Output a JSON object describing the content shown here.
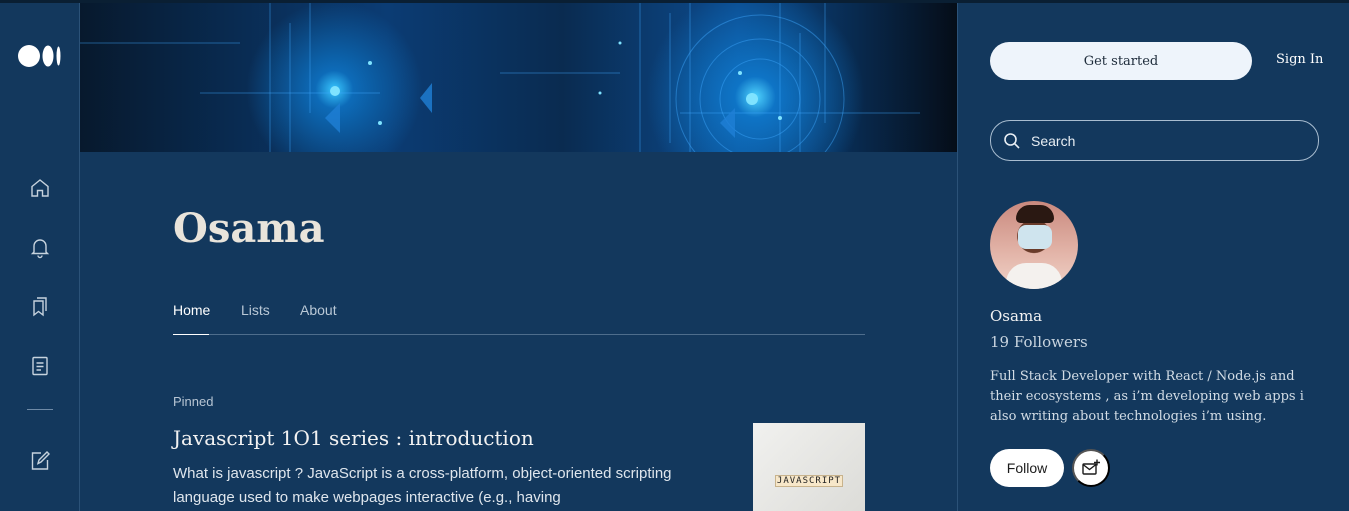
{
  "rail": {
    "logo_icon": "medium-logo-icon",
    "items": [
      {
        "icon": "home-icon"
      },
      {
        "icon": "notification-bell-icon"
      },
      {
        "icon": "bookmarks-icon"
      },
      {
        "icon": "stories-icon"
      },
      {
        "icon": "write-icon"
      }
    ]
  },
  "profile": {
    "name": "Osama",
    "tabs": [
      {
        "label": "Home",
        "active": true
      },
      {
        "label": "Lists",
        "active": false
      },
      {
        "label": "About",
        "active": false
      }
    ]
  },
  "article": {
    "pinned_label": "Pinned",
    "title": "Javascript 1O1 series : introduction",
    "snippet": "What is javascript ? JavaScript is a cross-platform, object-oriented scripting language used to make webpages interactive (e.g., having",
    "thumbnail_text": "JAVASCRIPT"
  },
  "sidebar": {
    "get_started_label": "Get started",
    "sign_in_label": "Sign In",
    "search": {
      "placeholder": "Search",
      "value": ""
    },
    "author": {
      "name": "Osama",
      "followers": "19 Followers",
      "bio": "Full Stack Developer with React / Node.js and their ecosystems , as i’m developing web apps i also writing about technologies i’m using."
    },
    "follow_label": "Follow",
    "subscribe_icon": "mail-plus-icon"
  },
  "colors": {
    "background": "#13385d",
    "button_light": "#eef4fb",
    "divider": "#2b5278"
  }
}
